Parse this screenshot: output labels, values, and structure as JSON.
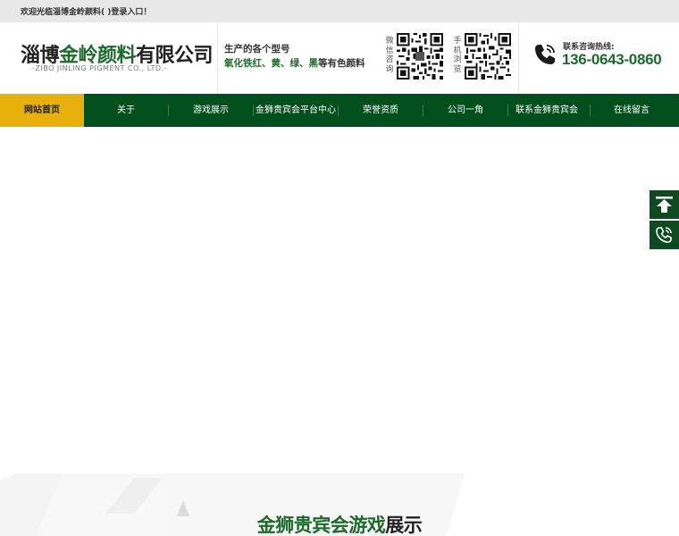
{
  "topbar": {
    "welcome_text": "欢迎光临淄博金岭颜料( )登录入口！"
  },
  "logo": {
    "name_pre": "淄博",
    "name_accent": "金岭颜料",
    "name_post": "有限公司",
    "subtitle": "-ZIBO JINLING PIGMENT CO., LTD.-"
  },
  "products": {
    "line1": "生产的各个型号",
    "line2_highlight": "氧化铁红、黄、绿、黑",
    "line2_rest": "等有色颜料"
  },
  "qr_codes": [
    {
      "label": "微信咨询",
      "icon": "qr-code-icon"
    },
    {
      "label": "手机浏览",
      "icon": "qr-code-icon"
    }
  ],
  "hotline": {
    "label": "联系咨询热线:",
    "number": "136-0643-0860",
    "icon": "phone-icon"
  },
  "nav": {
    "items": [
      {
        "label": "网站首页",
        "active": true
      },
      {
        "label": "关于"
      },
      {
        "label": "游戏展示"
      },
      {
        "label": "金狮贵宾会平台中心"
      },
      {
        "label": "荣誉资质"
      },
      {
        "label": "公司一角"
      },
      {
        "label": "联系金狮贵宾会"
      },
      {
        "label": "在线留言"
      }
    ]
  },
  "side_buttons": {
    "top_icon": "back-to-top-icon",
    "call_icon": "phone-icon"
  },
  "section": {
    "title_accent": "金狮贵宾会游戏",
    "title_rest": "展示"
  },
  "colors": {
    "brand_green": "#004f1c",
    "accent_green": "#1b6b2a",
    "active_yellow": "#e8b00a",
    "topbar_gray": "#e8e8e8"
  }
}
